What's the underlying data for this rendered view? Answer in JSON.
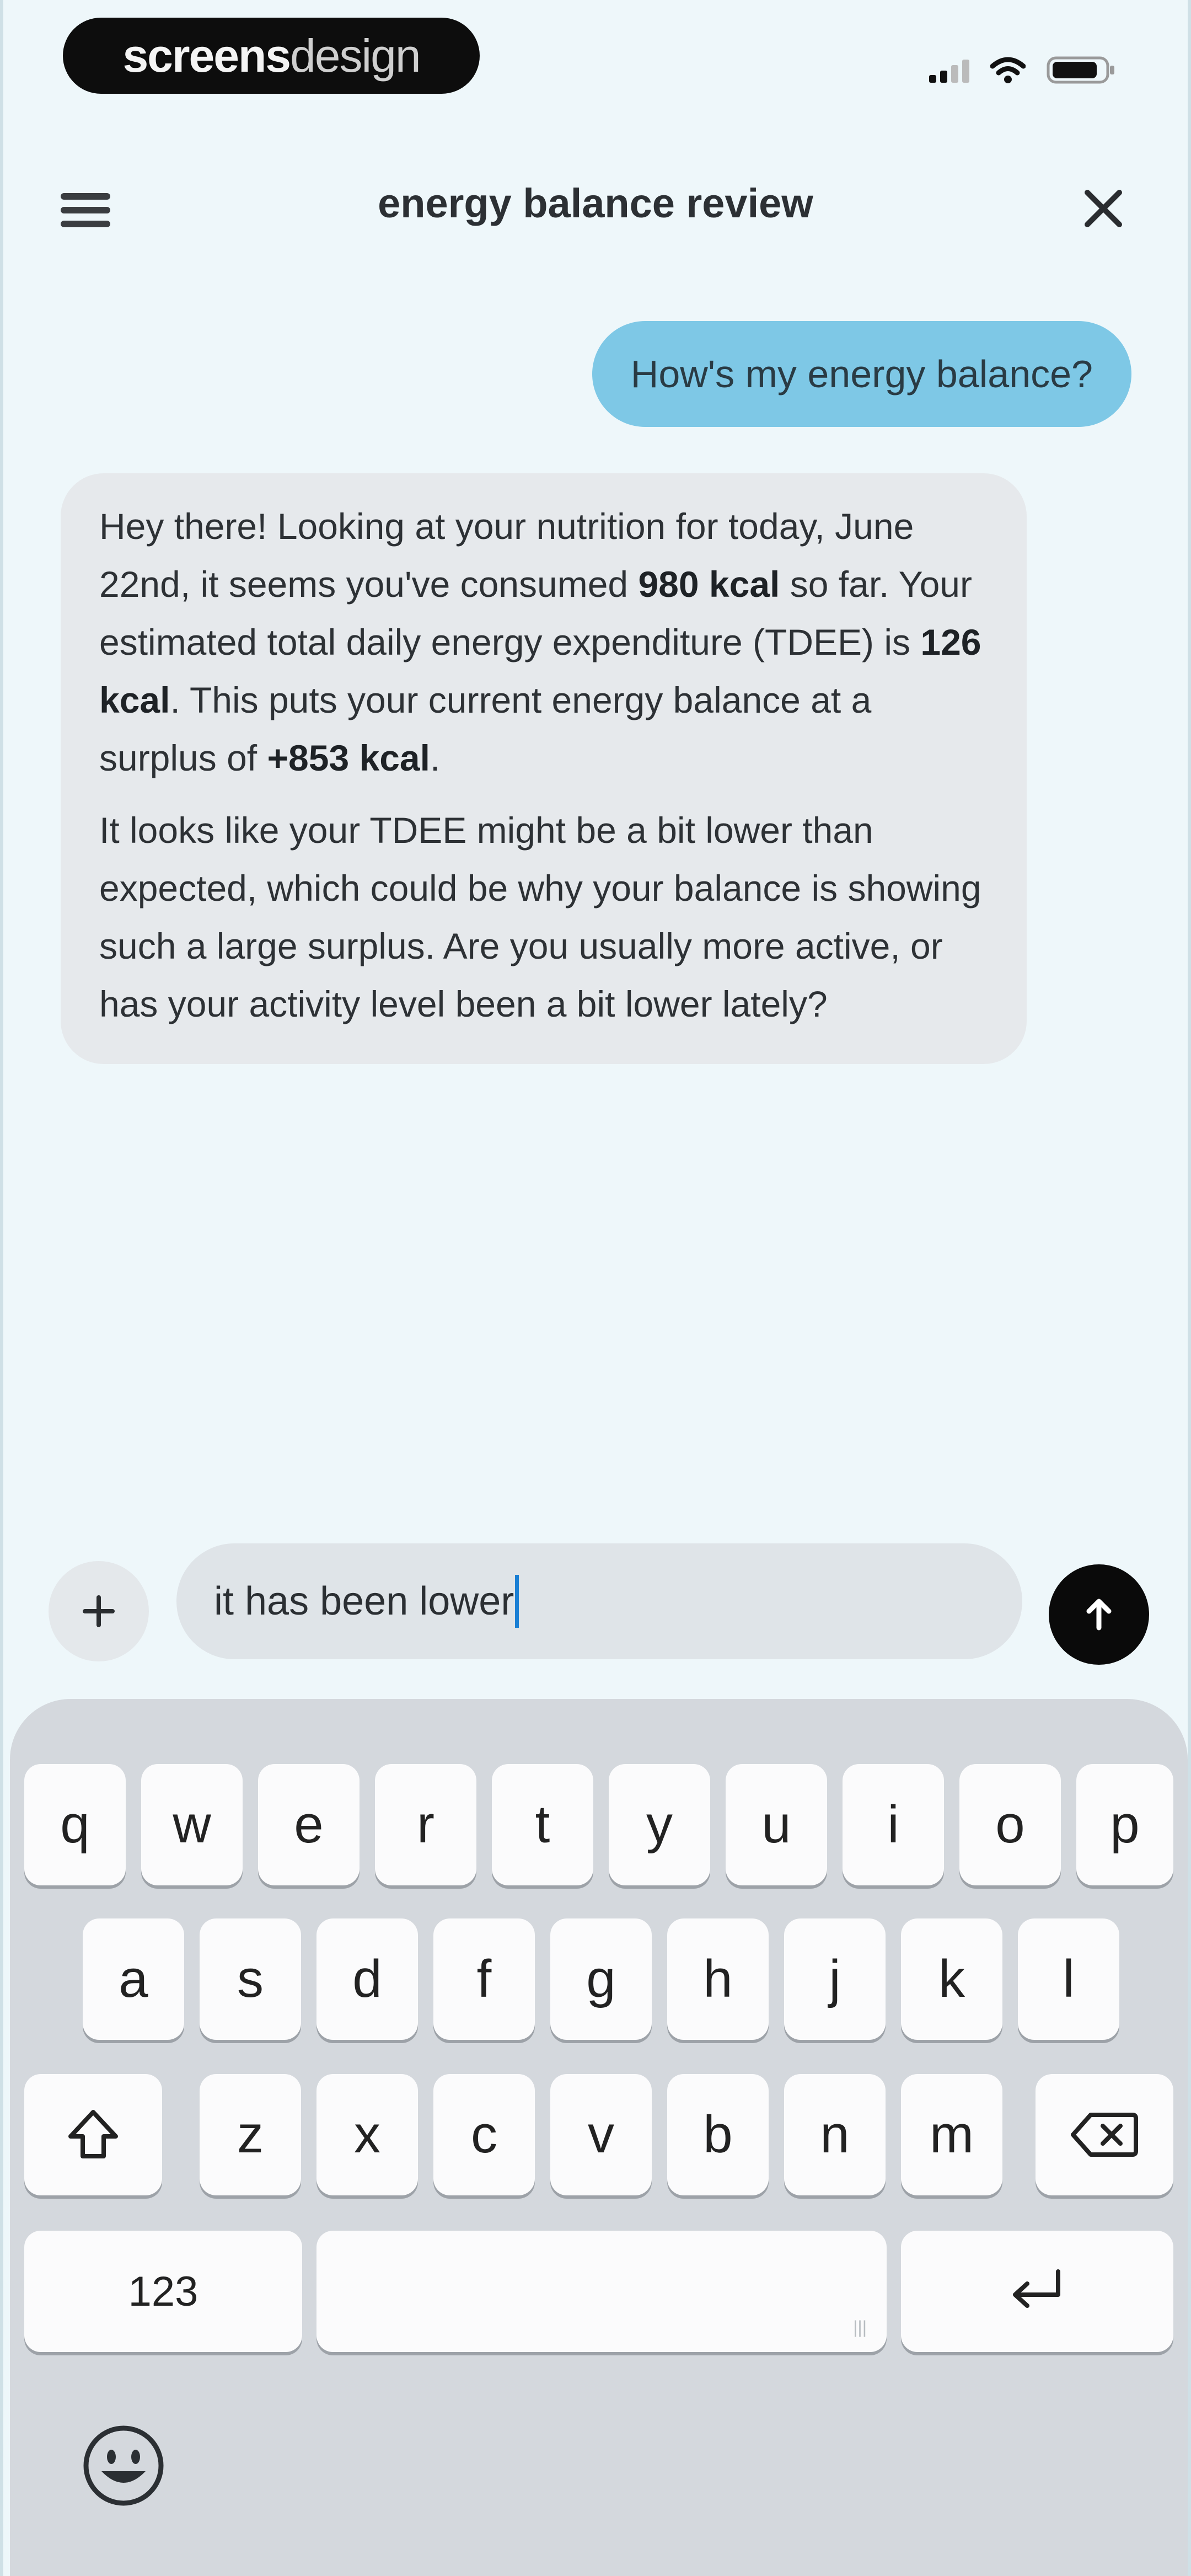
{
  "status_bar": {
    "brand_bold": "screens",
    "brand_light": "design"
  },
  "header": {
    "title": "energy balance review"
  },
  "messages": {
    "user": "How's my energy balance?",
    "assistant": {
      "p1_a": "Hey there! Looking at your nutrition for today, June 22nd, it seems you've consumed ",
      "p1_b": "980 kcal",
      "p1_c": " so far. Your estimated total daily energy expenditure (TDEE) is ",
      "p1_d": "126 kcal",
      "p1_e": ". This puts your current energy balance at a surplus of ",
      "p1_f": "+853 kcal",
      "p1_g": ".",
      "p2": "It looks like your TDEE might be a bit lower than expected, which could be why your balance is showing such a large surplus. Are you usually more active, or has your activity level been a bit lower lately?"
    }
  },
  "composer": {
    "input_value": "it has been lower"
  },
  "keyboard": {
    "row1": [
      "q",
      "w",
      "e",
      "r",
      "t",
      "y",
      "u",
      "i",
      "o",
      "p"
    ],
    "row2": [
      "a",
      "s",
      "d",
      "f",
      "g",
      "h",
      "j",
      "k",
      "l"
    ],
    "row3": [
      "z",
      "x",
      "c",
      "v",
      "b",
      "n",
      "m"
    ],
    "numbers_label": "123",
    "space_hint": "|||"
  },
  "colors": {
    "user_bubble": "#7ec8e6",
    "assistant_bubble": "#e6e9ec",
    "send_button": "#0a0a0a",
    "caret": "#1a7fd4"
  }
}
